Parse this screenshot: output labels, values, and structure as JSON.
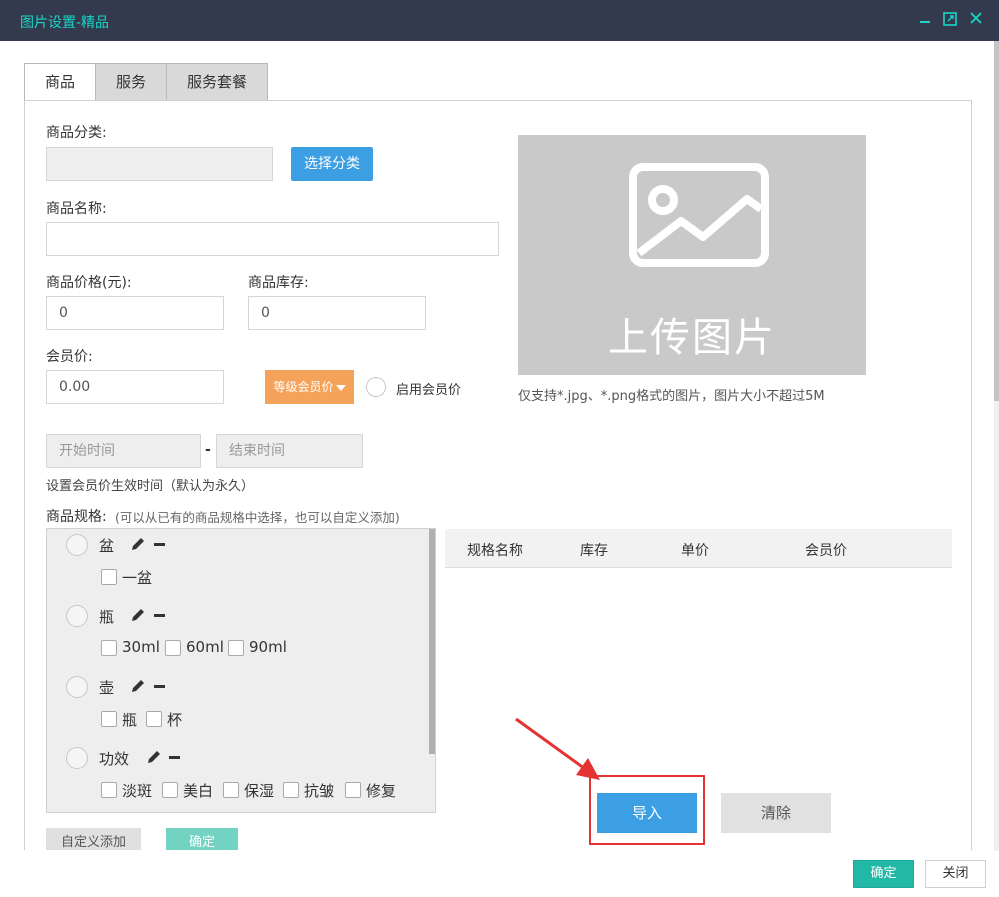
{
  "window": {
    "title": "图片设置-精品"
  },
  "tabs": [
    {
      "label": "商品"
    },
    {
      "label": "服务"
    },
    {
      "label": "服务套餐"
    }
  ],
  "form": {
    "category_label": "商品分类:",
    "category_value": "",
    "select_category_btn": "选择分类",
    "name_label": "商品名称:",
    "name_value": "",
    "price_label": "商品价格(元):",
    "price_value": "0",
    "stock_label": "商品库存:",
    "stock_value": "0",
    "member_price_label": "会员价:",
    "member_price_value": "0.00",
    "level_member_price_btn": "等级会员价",
    "enable_member_price_label": "启用会员价",
    "start_time_placeholder": "开始时间",
    "time_separator": "-",
    "end_time_placeholder": "结束时间",
    "time_hint": "设置会员价生效时间（默认为永久）",
    "spec_label": "商品规格:",
    "spec_hint": "(可以从已有的商品规格中选择，也可以自定义添加)"
  },
  "upload": {
    "text": "上传图片",
    "hint": "仅支持*.jpg、*.png格式的图片，图片大小不超过5M"
  },
  "spec_groups": [
    {
      "name": "盆",
      "options": [
        "一盆"
      ]
    },
    {
      "name": "瓶",
      "options": [
        "30ml",
        "60ml",
        "90ml"
      ]
    },
    {
      "name": "壶",
      "options": [
        "瓶",
        "杯"
      ]
    },
    {
      "name": "功效",
      "options": [
        "淡斑",
        "美白",
        "保湿",
        "抗皱",
        "修复"
      ]
    }
  ],
  "spec_table": {
    "headers": [
      "规格名称",
      "库存",
      "单价",
      "会员价"
    ]
  },
  "spec_buttons": {
    "custom_add": "自定义添加",
    "confirm": "确定"
  },
  "actions": {
    "import": "导入",
    "clear": "清除"
  },
  "footer": {
    "ok": "确定",
    "close": "关闭"
  },
  "colors": {
    "titlebar_bg": "#343a4e",
    "title_text": "#19d6c8",
    "primary_blue": "#3d9fe3",
    "orange": "#f5a35b",
    "teal": "#22b8a6",
    "annotation_red": "#e53333"
  }
}
